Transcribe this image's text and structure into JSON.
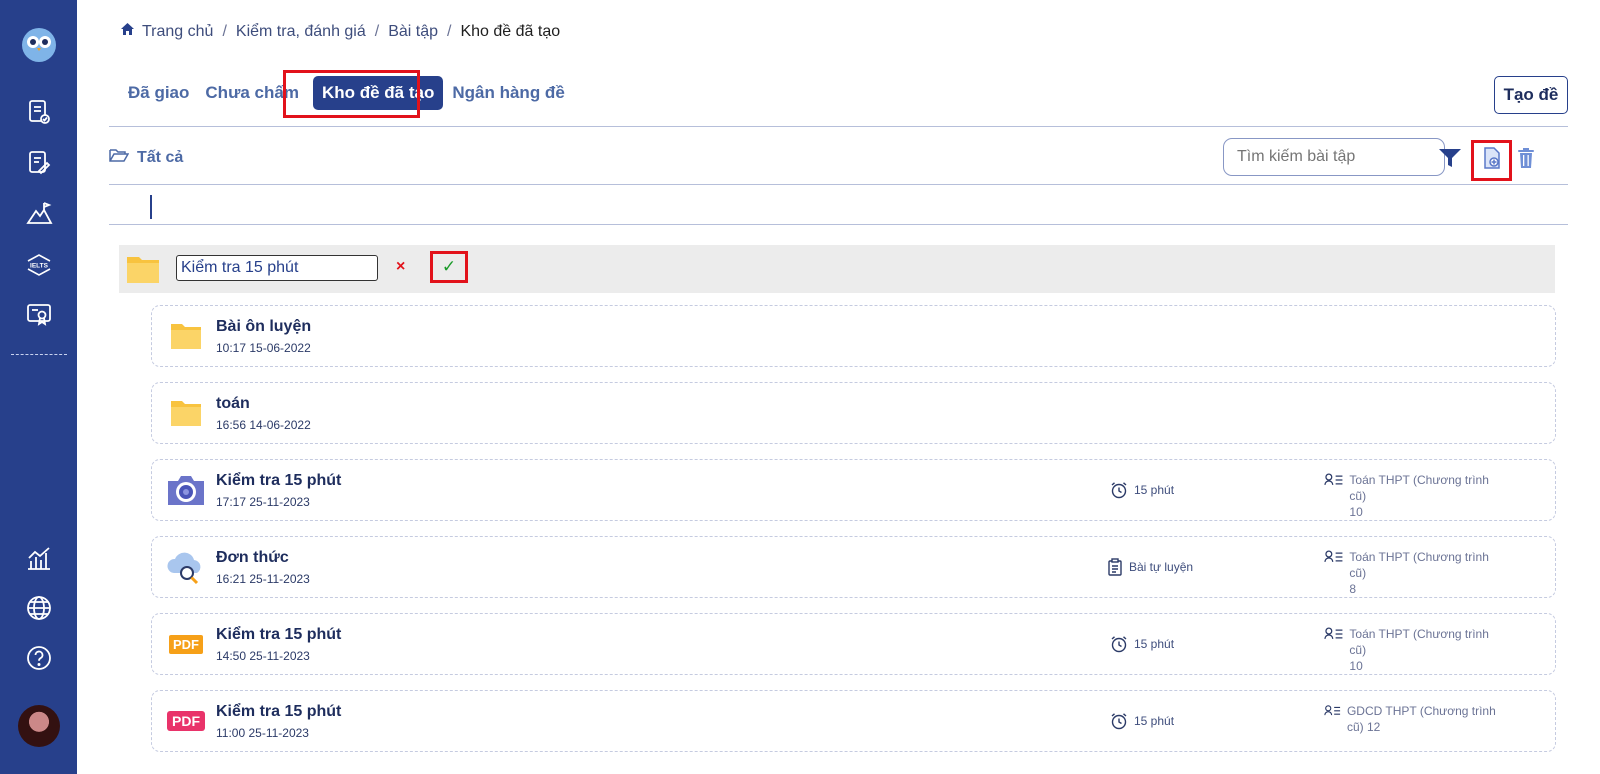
{
  "breadcrumb": [
    "Trang chủ",
    "Kiểm tra, đánh giá",
    "Bài tập",
    "Kho đề đã tạo"
  ],
  "tabs": [
    {
      "label": "Đã giao",
      "active": false
    },
    {
      "label": "Chưa chấm",
      "active": false
    },
    {
      "label": "Kho đề đã tạo",
      "active": true
    },
    {
      "label": "Ngân hàng đề",
      "active": false
    }
  ],
  "create_button": "Tạo đề",
  "folder_filter": "Tất cả",
  "search": {
    "placeholder": "Tìm kiếm bài tập"
  },
  "rename_row": {
    "value": "Kiểm tra 15 phút",
    "cancel": "×",
    "confirm": "✓"
  },
  "items": [
    {
      "type": "folder",
      "title": "Bài ôn luyện",
      "date": "10:17 15-06-2022",
      "meta": "",
      "subject": "",
      "grade": ""
    },
    {
      "type": "folder",
      "title": "toán",
      "date": "16:56 14-06-2022",
      "meta": "",
      "subject": "",
      "grade": ""
    },
    {
      "type": "camera",
      "title": "Kiểm tra 15 phút",
      "date": "17:17 25-11-2023",
      "meta": "15 phút",
      "subject": "Toán THPT (Chương trình cũ)",
      "grade": "10"
    },
    {
      "type": "cloud",
      "title": "Đơn thức",
      "date": "16:21 25-11-2023",
      "meta": "Bài tự luyện",
      "subject": "Toán THPT (Chương trình cũ)",
      "grade": "8"
    },
    {
      "type": "pdf-orange",
      "title": "Kiểm tra 15 phút",
      "date": "14:50 25-11-2023",
      "meta": "15 phút",
      "subject": "Toán THPT (Chương trình cũ)",
      "grade": "10"
    },
    {
      "type": "pdf-pink",
      "title": "Kiểm tra 15 phút",
      "date": "11:00 25-11-2023",
      "meta": "15 phút",
      "subject": "GDCD THPT (Chương trình cũ)",
      "grade": "12"
    }
  ],
  "icons": {
    "pdf_label": "PDF",
    "pdf_orange_label": "PDF",
    "logo_text": ""
  },
  "colors": {
    "primary": "#27408b",
    "highlight": "#e2121b",
    "confirm": "#1b9b2a",
    "folder": "#f8c33f"
  }
}
